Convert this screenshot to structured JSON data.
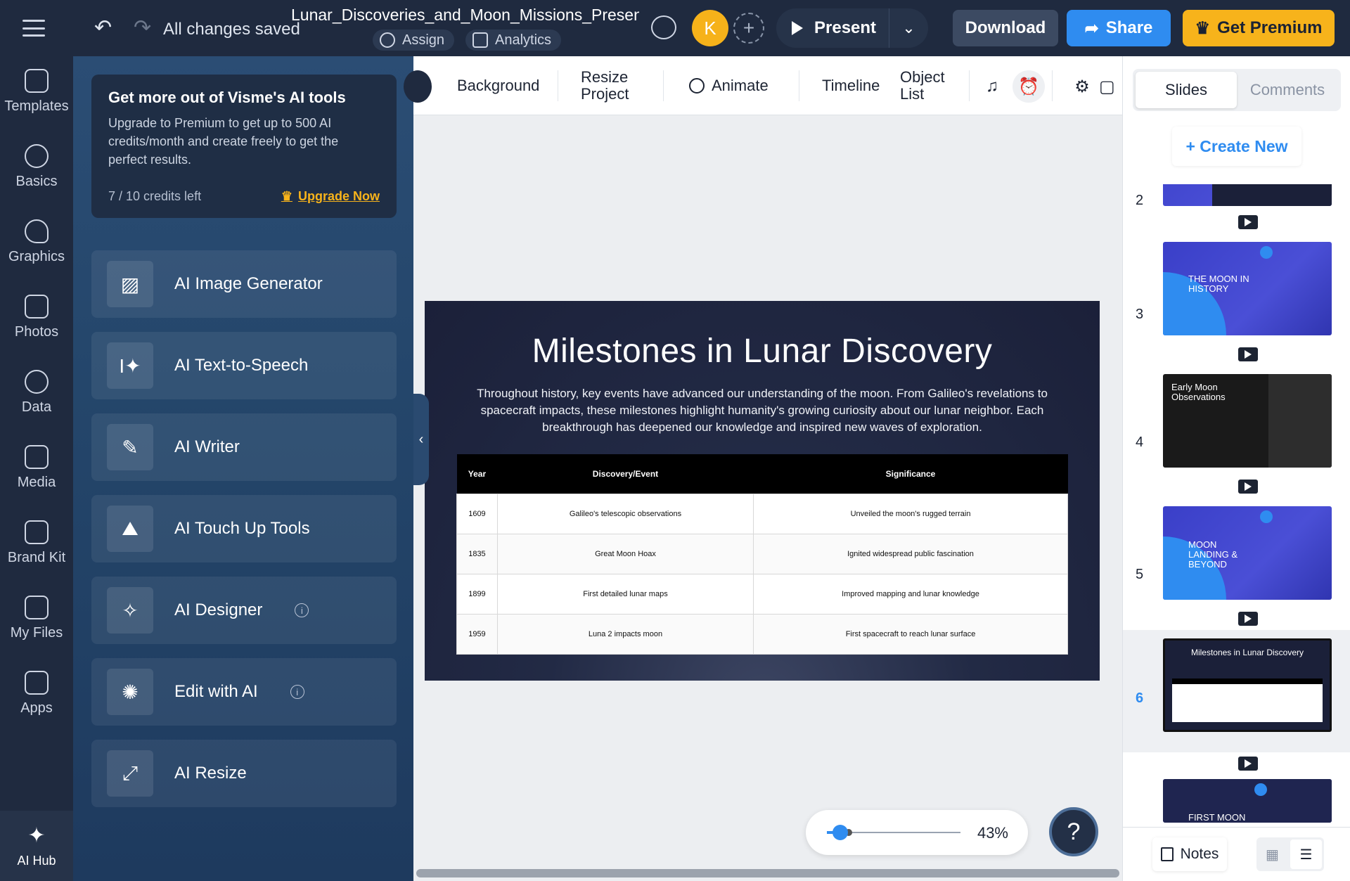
{
  "topbar": {
    "saved_status": "All changes saved",
    "doc_title": "Lunar_Discoveries_and_Moon_Missions_Present...",
    "assign": "Assign",
    "analytics": "Analytics",
    "avatar_initial": "K",
    "present": "Present",
    "download": "Download",
    "share": "Share",
    "get_premium": "Get Premium"
  },
  "leftnav": [
    {
      "label": "Templates",
      "icon": "templates-icon"
    },
    {
      "label": "Basics",
      "icon": "basics-icon"
    },
    {
      "label": "Graphics",
      "icon": "graphics-icon"
    },
    {
      "label": "Photos",
      "icon": "photos-icon"
    },
    {
      "label": "Data",
      "icon": "data-icon"
    },
    {
      "label": "Media",
      "icon": "media-icon"
    },
    {
      "label": "Brand Kit",
      "icon": "brand-kit-icon"
    },
    {
      "label": "My Files",
      "icon": "folder-icon"
    },
    {
      "label": "Apps",
      "icon": "apps-grid-icon"
    },
    {
      "label": "AI Hub",
      "icon": "sparkle-icon"
    }
  ],
  "aipanel": {
    "promo_title": "Get more out of Visme's AI tools",
    "promo_body": "Upgrade to Premium to get up to 500 AI credits/month and create freely to get the perfect results.",
    "credits": "7 / 10 credits left",
    "upgrade": "Upgrade Now",
    "items": [
      {
        "label": "AI Image Generator"
      },
      {
        "label": "AI Text-to-Speech"
      },
      {
        "label": "AI Writer"
      },
      {
        "label": "AI Touch Up Tools"
      },
      {
        "label": "AI Designer"
      },
      {
        "label": "Edit with AI"
      },
      {
        "label": "AI Resize"
      }
    ]
  },
  "toolbar": {
    "background": "Background",
    "resize_1": "Resize",
    "resize_2": "Project",
    "animate": "Animate",
    "timeline": "Timeline",
    "object_1": "Object",
    "object_2": "List"
  },
  "slide": {
    "title": "Milestones in Lunar Discovery",
    "subtitle": "Throughout history, key events have advanced our understanding of the moon. From Galileo's revelations to spacecraft impacts, these milestones highlight humanity's growing curiosity about our lunar neighbor. Each breakthrough has deepened our knowledge and inspired new waves of exploration.",
    "table_headers": [
      "Year",
      "Discovery/Event",
      "Significance"
    ],
    "table_rows": [
      [
        "1609",
        "Galileo's telescopic observations",
        "Unveiled the moon's rugged terrain"
      ],
      [
        "1835",
        "Great Moon Hoax",
        "Ignited widespread public fascination"
      ],
      [
        "1899",
        "First detailed lunar maps",
        "Improved mapping and lunar knowledge"
      ],
      [
        "1959",
        "Luna 2 impacts moon",
        "First spacecraft to reach lunar surface"
      ]
    ]
  },
  "zoom": {
    "value": "43%",
    "level": 0.1
  },
  "help": "?",
  "rightpanel": {
    "tab_slides": "Slides",
    "tab_comments": "Comments",
    "create_new": "+ Create New",
    "slides": [
      {
        "num": "2"
      },
      {
        "num": "3",
        "text": "THE MOON IN HISTORY"
      },
      {
        "num": "4",
        "text": "Early Moon Observations"
      },
      {
        "num": "5",
        "text": "MOON LANDING & BEYOND"
      },
      {
        "num": "6",
        "text": "Milestones in Lunar Discovery"
      },
      {
        "num": "",
        "text": "FIRST MOON LANDING"
      }
    ],
    "notes": "Notes"
  }
}
